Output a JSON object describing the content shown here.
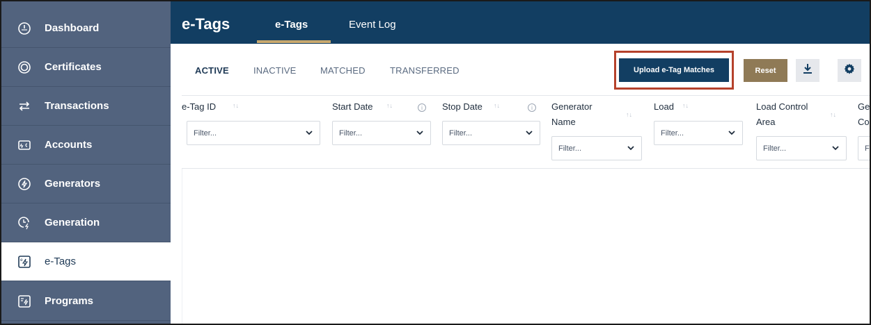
{
  "sidebar": {
    "items": [
      {
        "label": "Dashboard",
        "icon": "dashboard-gauge-icon"
      },
      {
        "label": "Certificates",
        "icon": "certificate-icon"
      },
      {
        "label": "Transactions",
        "icon": "transfer-arrows-icon"
      },
      {
        "label": "Accounts",
        "icon": "account-card-icon"
      },
      {
        "label": "Generators",
        "icon": "bolt-circle-icon"
      },
      {
        "label": "Generation",
        "icon": "clock-bolt-icon"
      },
      {
        "label": "e-Tags",
        "icon": "etag-icon"
      },
      {
        "label": "Programs",
        "icon": "program-doc-icon"
      }
    ],
    "active": "e-Tags"
  },
  "header": {
    "title": "e-Tags",
    "tabs": [
      {
        "label": "e-Tags",
        "active": true
      },
      {
        "label": "Event Log",
        "active": false
      }
    ]
  },
  "subtabs": [
    {
      "label": "ACTIVE",
      "active": true
    },
    {
      "label": "INACTIVE",
      "active": false
    },
    {
      "label": "MATCHED",
      "active": false
    },
    {
      "label": "TRANSFERRED",
      "active": false
    }
  ],
  "toolbar": {
    "upload_label": "Upload e-Tag Matches",
    "reset_label": "Reset",
    "download_icon": "download-icon",
    "settings_icon": "gear-icon"
  },
  "table": {
    "columns": [
      {
        "label": "e-Tag ID",
        "filter_placeholder": "Filter..."
      },
      {
        "label": "Start Date",
        "filter_placeholder": "Filter..."
      },
      {
        "label": "Stop Date",
        "filter_placeholder": "Filter..."
      },
      {
        "label_line1": "Generator",
        "label_line2": "Name",
        "filter_placeholder": "Filter..."
      },
      {
        "label": "Load",
        "filter_placeholder": "Filter..."
      },
      {
        "label_line1": "Load Control",
        "label_line2": "Area",
        "filter_placeholder": "Filter..."
      },
      {
        "label_line1": "Ge",
        "label_line2": "Co",
        "filter_placeholder": "F"
      }
    ],
    "rows": []
  },
  "colors": {
    "sidebar_bg": "#52637e",
    "header_bg": "#123e62",
    "primary_button": "#123e62",
    "reset_button": "#8f7a56",
    "tab_underline": "#c9a96e",
    "highlight_border": "#b5412b"
  }
}
